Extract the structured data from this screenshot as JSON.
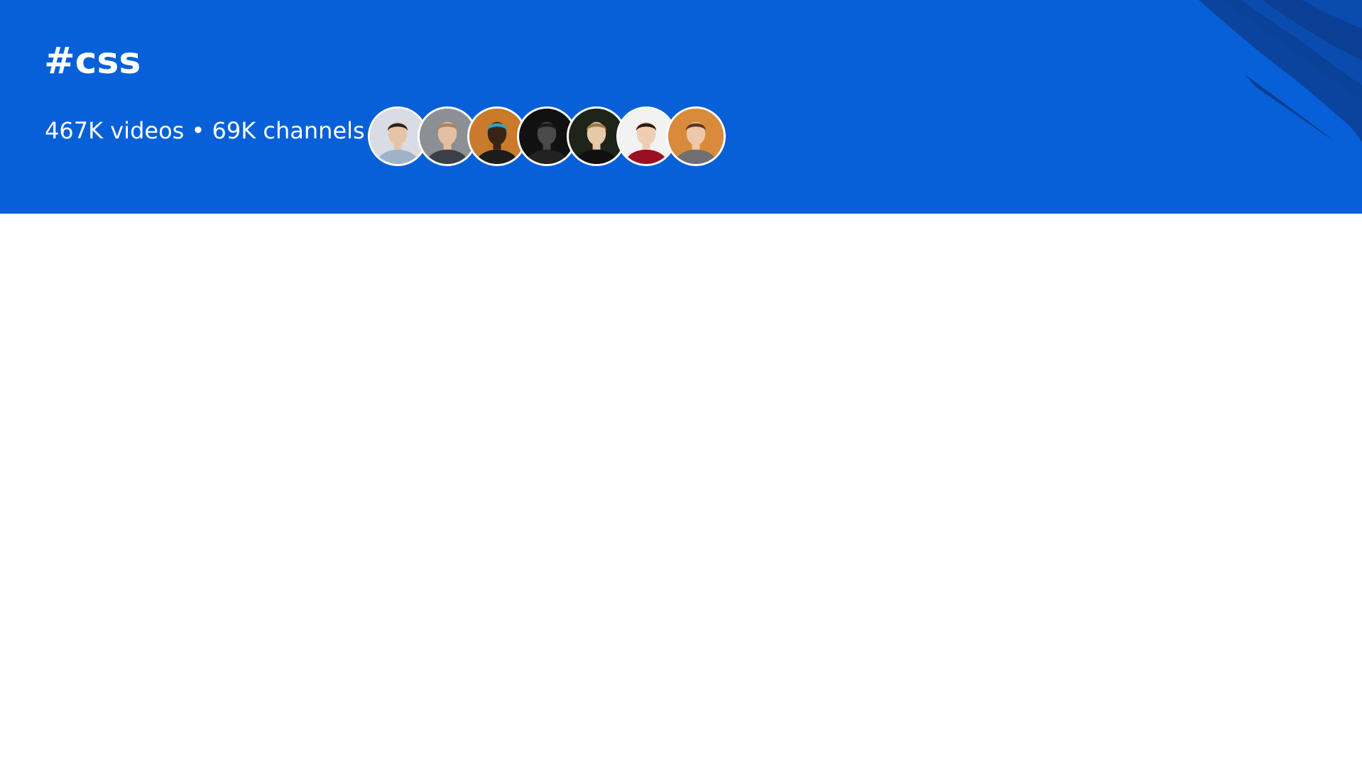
{
  "header": {
    "hashtag": "#css",
    "stats": "467K videos • 69K channels",
    "accent_color": "#0760d8",
    "brush_color": "#0a4aa8"
  },
  "avatars": [
    {
      "icon": "person-avatar",
      "bg": "#d9dde3",
      "skin": "#e7c4a8",
      "hair": "#2b2420",
      "shirt": "#9fb3c8"
    },
    {
      "icon": "person-avatar",
      "bg": "#8c8f94",
      "skin": "#e3bfa2",
      "hair": "#a8865c",
      "shirt": "#3b4048"
    },
    {
      "icon": "person-avatar",
      "bg": "#c97a2a",
      "skin": "#3a2418",
      "hair": "#2aa6c9",
      "shirt": "#1c1c1c"
    },
    {
      "icon": "person-avatar",
      "bg": "#111111",
      "skin": "#4a4a4a",
      "hair": "#1a1a1a",
      "shirt": "#222222"
    },
    {
      "icon": "person-avatar",
      "bg": "#1f2418",
      "skin": "#e6c9a6",
      "hair": "#9a7a4c",
      "shirt": "#101010"
    },
    {
      "icon": "person-avatar",
      "bg": "#f2f2f2",
      "skin": "#f0cdb2",
      "hair": "#2a1a14",
      "shirt": "#9a1022"
    },
    {
      "icon": "person-avatar",
      "bg": "#d98a3a",
      "skin": "#edc8a8",
      "hair": "#5a3a22",
      "shirt": "#6f6f72"
    }
  ]
}
